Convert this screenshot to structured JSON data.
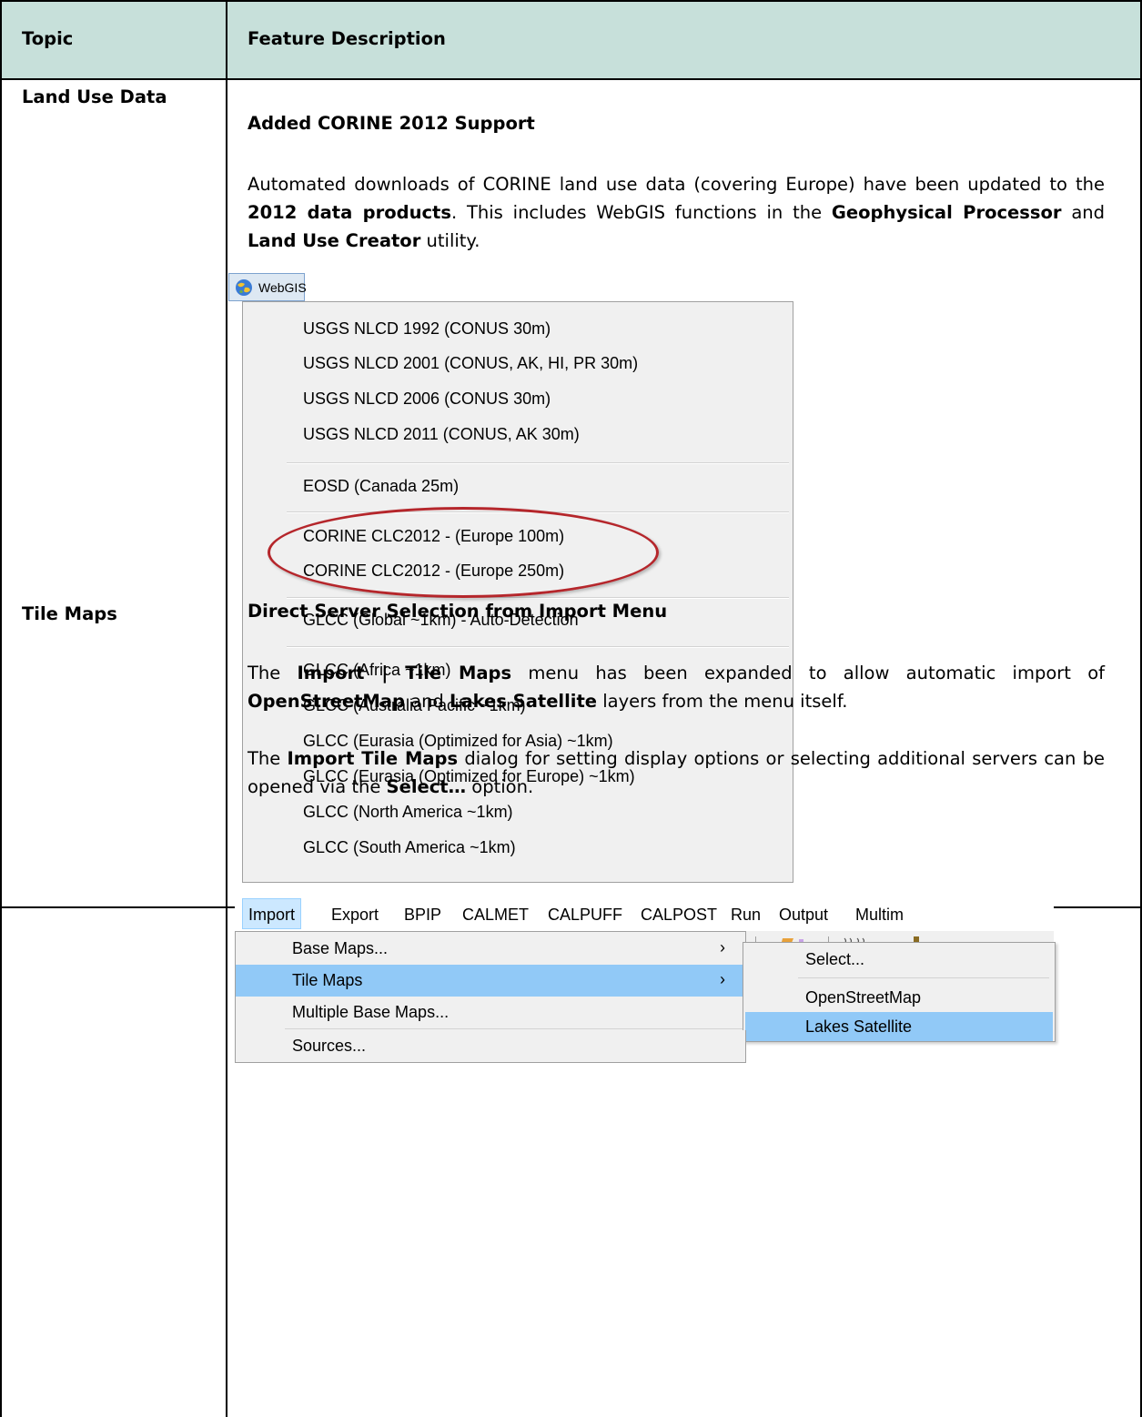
{
  "header": {
    "topic": "Topic",
    "feature": "Feature Description"
  },
  "rows": [
    {
      "topic": "Land Use Data",
      "title": "Added CORINE 2012 Support",
      "para1": [
        {
          "t": "Automated downloads of CORINE land use data (covering Europe) have been updated to the ",
          "b": false
        },
        {
          "t": "2012 data products",
          "b": true
        },
        {
          "t": ". This includes WebGIS functions in the ",
          "b": false
        },
        {
          "t": "Geophysical Processor",
          "b": true
        },
        {
          "t": " and ",
          "b": false
        },
        {
          "t": "Land Use Creator",
          "b": true
        },
        {
          "t": " utility.",
          "b": false
        }
      ],
      "webgis": {
        "button_label": "WebGIS",
        "icon": "globe-icon",
        "items": [
          "USGS NLCD 1992 (CONUS 30m)",
          "USGS NLCD 2001 (CONUS, AK, HI, PR  30m)",
          "USGS NLCD 2006 (CONUS 30m)",
          "USGS NLCD 2011 (CONUS, AK  30m)",
          "EOSD (Canada 25m)",
          "CORINE CLC2012 - (Europe 100m)",
          "CORINE CLC2012 - (Europe 250m)",
          "GLCC (Global ~1km) - Auto-Detection",
          "GLCC (Africa ~1km)",
          "GLCC (Australia Pacific ~1km)",
          "GLCC (Eurasia (Optimized for Asia) ~1km)",
          "GLCC (Eurasia (Optimized for Europe) ~1km)",
          "GLCC (North America ~1km)",
          "GLCC (South America ~1km)"
        ],
        "highlight_color": "#b5262b"
      }
    },
    {
      "topic": "Tile Maps",
      "title": "Direct Server Selection from Import Menu",
      "para1": [
        {
          "t": "The ",
          "b": false
        },
        {
          "t": "Import | Tile Maps",
          "b": true
        },
        {
          "t": " menu has been expanded to allow automatic import of ",
          "b": false
        },
        {
          "t": "OpenStreetMap",
          "b": true
        },
        {
          "t": " and ",
          "b": false
        },
        {
          "t": "Lakes Satellite",
          "b": true
        },
        {
          "t": " layers from the menu itself.",
          "b": false
        }
      ],
      "para2": [
        {
          "t": "The ",
          "b": false
        },
        {
          "t": "Import Tile Maps",
          "b": true
        },
        {
          "t": " dialog for setting display options or selecting additional servers can be opened via the ",
          "b": false
        },
        {
          "t": "Select…",
          "b": true
        },
        {
          "t": " option.",
          "b": false
        }
      ],
      "menubar": [
        "Import",
        "Export",
        "BPIP",
        "CALMET",
        "CALPUFF",
        "CALPOST",
        "Run",
        "Output",
        "Multim"
      ],
      "import_menu": [
        "Base Maps...",
        "Tile Maps",
        "Multiple Base Maps...",
        "Sources..."
      ],
      "submenu": [
        "Select...",
        "OpenStreetMap",
        "Lakes Satellite"
      ],
      "selection_color": "#91c9f7"
    }
  ]
}
